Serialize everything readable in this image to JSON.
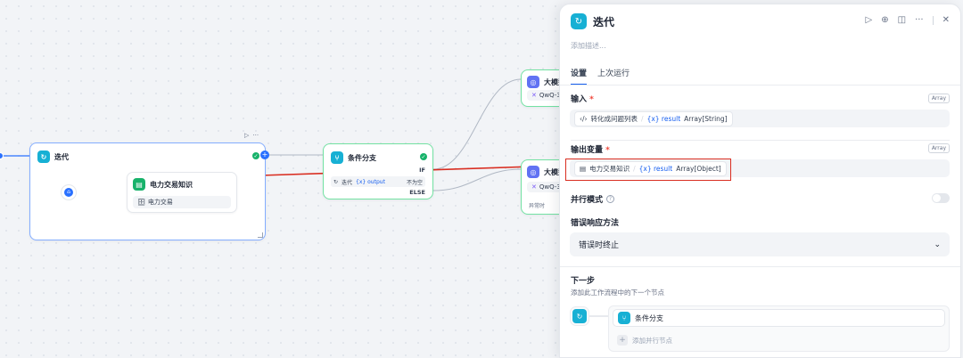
{
  "canvas": {
    "iteration_node": {
      "title": "迭代",
      "run_icon": "play-icon",
      "more_icon": "more-icon"
    },
    "knowledge_node": {
      "title": "电力交易知识",
      "dataset_tag": "电力交易"
    },
    "condition_node": {
      "title": "条件分支",
      "if_label": "IF",
      "else_label": "ELSE",
      "cond_var_node": "迭代",
      "cond_var": "{x} output",
      "cond_op": "不为空"
    },
    "llm_node_top": {
      "title": "大模型",
      "model": "QwQ-3"
    },
    "llm_node_bottom": {
      "title": "大模型",
      "model": "QwQ-3",
      "footer": "异常时"
    }
  },
  "panel": {
    "title": "迭代",
    "description_placeholder": "添加描述...",
    "tabs": [
      {
        "label": "设置",
        "active": true
      },
      {
        "label": "上次运行",
        "active": false
      }
    ],
    "input": {
      "label": "输入",
      "type": "Array",
      "source_node": "转化成问题列表",
      "var_name": "{x} result",
      "var_type": "Array[String]"
    },
    "output": {
      "label": "输出变量",
      "type": "Array",
      "source_node": "电力交易知识",
      "var_name": "{x} result",
      "var_type": "Array[Object]"
    },
    "parallel": {
      "label": "并行模式",
      "enabled": false
    },
    "error_handling": {
      "label": "错误响应方法",
      "selected": "错误时终止"
    },
    "next": {
      "title": "下一步",
      "description": "添加此工作流程中的下一个节点",
      "items": [
        "条件分支"
      ],
      "add_label": "添加并行节点"
    }
  },
  "colors": {
    "accent": "#155eef",
    "iteration": "#17b0d4",
    "knowledge": "#17b26a",
    "highlight": "#d92d20"
  }
}
